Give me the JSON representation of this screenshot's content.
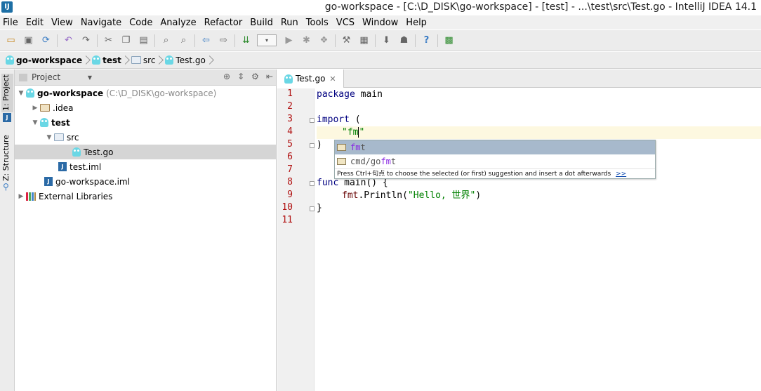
{
  "window": {
    "title": "go-workspace - [C:\\D_DISK\\go-workspace] - [test] - ...\\test\\src\\Test.go - IntelliJ IDEA 14.1",
    "logo_text": "IJ"
  },
  "menu": [
    "File",
    "Edit",
    "View",
    "Navigate",
    "Code",
    "Analyze",
    "Refactor",
    "Build",
    "Run",
    "Tools",
    "VCS",
    "Window",
    "Help"
  ],
  "toolbar": {
    "icons": [
      "open-folder",
      "save",
      "sync",
      "undo",
      "redo",
      "cut",
      "copy",
      "paste",
      "find",
      "find-replace",
      "back",
      "forward",
      "make",
      "run-config",
      "run",
      "debug",
      "coverage",
      "build-settings",
      "sdk",
      "android",
      "help",
      "plugins"
    ]
  },
  "breadcrumbs": [
    "go-workspace",
    "test",
    "src",
    "Test.go"
  ],
  "side_tabs": {
    "project": "1: Project",
    "structure": "Z: Structure"
  },
  "project_panel": {
    "selector": "Project",
    "tree": [
      {
        "label": "go-workspace",
        "hint": "(C:\\D_DISK\\go-workspace)",
        "icon": "go-module-icon",
        "depth": 0,
        "expanded": true,
        "bold": true
      },
      {
        "label": ".idea",
        "icon": "folder-icon",
        "depth": 1,
        "expanded": false,
        "bold": false
      },
      {
        "label": "test",
        "icon": "go-module-icon",
        "depth": 1,
        "expanded": true,
        "bold": true
      },
      {
        "label": "src",
        "icon": "source-folder-icon",
        "depth": 2,
        "expanded": true,
        "bold": false
      },
      {
        "label": "Test.go",
        "icon": "go-file-icon",
        "depth": 3,
        "selected": true,
        "bold": false
      },
      {
        "label": "test.iml",
        "icon": "iml-file-icon",
        "depth": 2,
        "bold": false
      },
      {
        "label": "go-workspace.iml",
        "icon": "iml-file-icon",
        "depth": 1,
        "bold": false
      },
      {
        "label": "External Libraries",
        "icon": "library-icon",
        "depth": 0,
        "expanded": false,
        "bold": false
      }
    ]
  },
  "editor": {
    "tab": "Test.go",
    "line_numbers": [
      "1",
      "2",
      "3",
      "4",
      "5",
      "6",
      "7",
      "8",
      "9",
      "10",
      "11"
    ],
    "current_line": 4,
    "lines": {
      "l1_kw": "package",
      "l1_rest": " main",
      "l3_kw": "import",
      "l3_rest": " (",
      "l4_q1": "\"",
      "l4_str": "fm",
      "l4_q2": "\"",
      "l5": ")",
      "l8_kw": "func",
      "l8_rest": " main() {",
      "l9_pkg": "fmt",
      "l9_call": ".Println(",
      "l9_str": "\"Hello, 世界\"",
      "l9_end": ")",
      "l10": "}"
    }
  },
  "completion": {
    "items": [
      {
        "prefix": "",
        "match": "fm",
        "rest": "t"
      },
      {
        "prefix": "cmd/go",
        "match": "fm",
        "rest": "t"
      }
    ],
    "footer": "Press Ctrl+句点 to choose the selected (or first) suggestion and insert a dot afterwards",
    "footer_link": ">>"
  }
}
